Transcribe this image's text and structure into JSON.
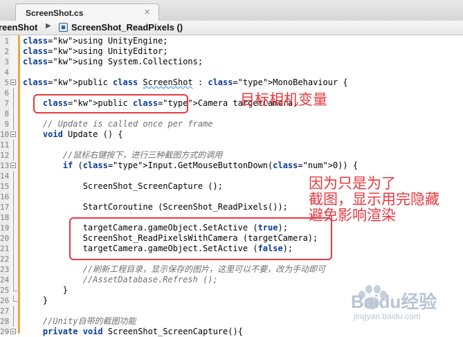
{
  "tab": {
    "title": "ScreenShot.cs",
    "close": "×"
  },
  "breadcrumb": {
    "class_name": "reenShot",
    "separator": "▶",
    "method_name": "ScreenShot_ReadPixels ()"
  },
  "lines": [
    {
      "n": "1",
      "t": "using UnityEngine;"
    },
    {
      "n": "2",
      "t": "using UnityEditor;"
    },
    {
      "n": "3",
      "t": "using System.Collections;"
    },
    {
      "n": "4",
      "t": ""
    },
    {
      "n": "5",
      "t": "public class ScreenShot : MonoBehaviour {"
    },
    {
      "n": "6",
      "t": ""
    },
    {
      "n": "7",
      "t": "    public Camera targetCamera;"
    },
    {
      "n": "8",
      "t": ""
    },
    {
      "n": "9",
      "t": "    // Update is called once per frame"
    },
    {
      "n": "10",
      "t": "    void Update () {"
    },
    {
      "n": "11",
      "t": ""
    },
    {
      "n": "12",
      "t": "        //鼠标右键按下，进行三种截图方式的调用"
    },
    {
      "n": "13",
      "t": "        if (Input.GetMouseButtonDown(0)) {"
    },
    {
      "n": "14",
      "t": ""
    },
    {
      "n": "15",
      "t": "            ScreenShot_ScreenCapture ();"
    },
    {
      "n": "16",
      "t": ""
    },
    {
      "n": "17",
      "t": "            StartCoroutine (ScreenShot_ReadPixels());"
    },
    {
      "n": "18",
      "t": ""
    },
    {
      "n": "19",
      "t": "            targetCamera.gameObject.SetActive (true);"
    },
    {
      "n": "20",
      "t": "            ScreenShot_ReadPixelsWithCamera (targetCamera);"
    },
    {
      "n": "21",
      "t": "            targetCamera.gameObject.SetActive (false);"
    },
    {
      "n": "22",
      "t": ""
    },
    {
      "n": "23",
      "t": "            //刷新工程目录，显示保存的图片，这里可以不要，改为手动即可"
    },
    {
      "n": "24",
      "t": "            //AssetDatabase.Refresh ();"
    },
    {
      "n": "25",
      "t": "        }"
    },
    {
      "n": "26",
      "t": "    }"
    },
    {
      "n": "27",
      "t": ""
    },
    {
      "n": "28",
      "t": "    //Unity自带的截图功能"
    },
    {
      "n": "29",
      "t": "    private void ScreenShot_ScreenCapture(){"
    }
  ],
  "annotations": {
    "camera_note": "目标相机变量",
    "setactive_note": "因为只是为了\n截图，显示用完隐藏\n避免影响渲染"
  },
  "watermark": {
    "brand": "Baidu经验",
    "url": "jingyan.baidu.com"
  },
  "colors": {
    "annotation_red": "#e8383e",
    "keyword_blue": "#0a3a9a",
    "gutter_orange": "#f0a24a"
  }
}
